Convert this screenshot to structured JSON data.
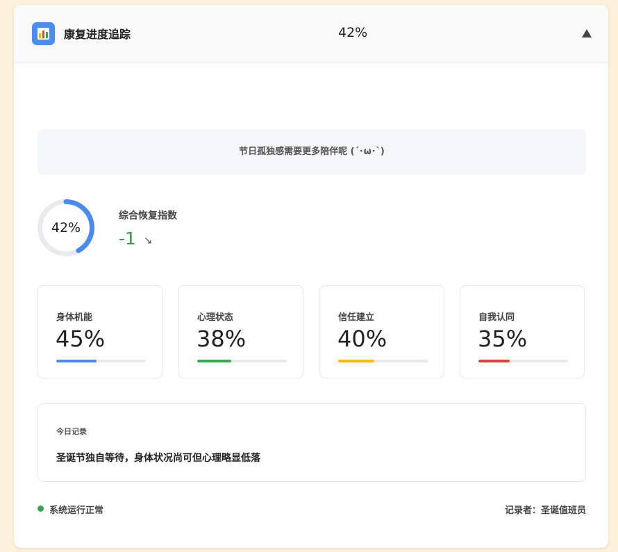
{
  "header": {
    "title": "康复进度追踪",
    "percent": "42%",
    "app_icon": "bar-chart-icon",
    "collapse_icon": "triangle-up-icon"
  },
  "notice": {
    "text": "节日孤独感需要更多陪伴呢 (´･ω･`)"
  },
  "summary": {
    "ring_label": "42%",
    "ring_value": 42,
    "index_label": "综合恢复指数",
    "index_value": "-1",
    "trend_icon": "↘"
  },
  "metrics": [
    {
      "label": "身体机能",
      "value": "45%",
      "progress": 45,
      "color": "#4a8af0"
    },
    {
      "label": "心理状态",
      "value": "38%",
      "progress": 38,
      "color": "#34a853"
    },
    {
      "label": "信任建立",
      "value": "40%",
      "progress": 40,
      "color": "#fbbc05"
    },
    {
      "label": "自我认同",
      "value": "35%",
      "progress": 35,
      "color": "#db4437"
    }
  ],
  "log": {
    "title": "今日记录",
    "text": "圣诞节独自等待，身体状况尚可但心理略显低落"
  },
  "footer": {
    "status": "系统运行正常",
    "recorder": "记录者：圣诞值班员"
  },
  "colors": {
    "accent": "#4a8af0",
    "positive": "#2e9a4b",
    "status_ok": "#34a853"
  }
}
